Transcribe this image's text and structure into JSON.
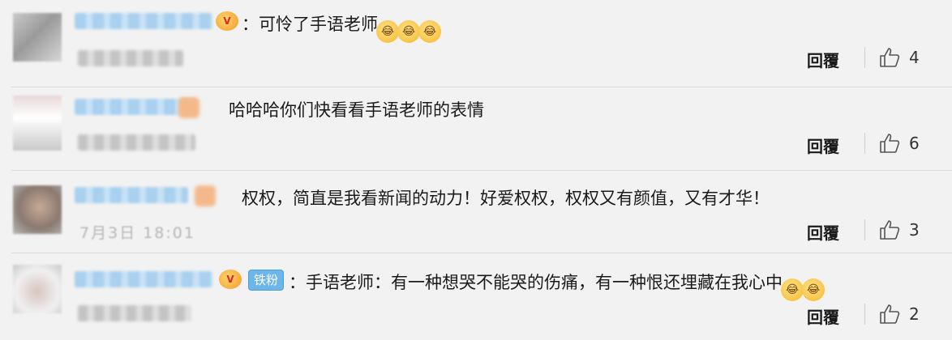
{
  "comments": [
    {
      "prefix": "：",
      "text": "可怜了手语老师",
      "emoji_count": 3,
      "emoji_icon": "laughing-crying-emoji",
      "badge_icon": "vip-crown-icon",
      "reply_label": "回覆",
      "likes": "4"
    },
    {
      "prefix": "",
      "text": "哈哈哈你们快看看手语老师的表情",
      "reply_label": "回覆",
      "likes": "6"
    },
    {
      "prefix": "",
      "text": "权权，简直是我看新闻的动力！好爱权权，权权又有颜值，又有才华！",
      "meta_text": "7月3日 18:01",
      "reply_label": "回覆",
      "likes": "3"
    },
    {
      "prefix": "：",
      "text": "手语老师：有一种想哭不能哭的伤痛，有一种恨还埋藏在我心中",
      "badge_icon": "vip-crown-icon",
      "fan_badge": "铁粉",
      "emoji_count": 2,
      "emoji_icon": "laughing-crying-emoji",
      "reply_label": "回覆",
      "likes": "2"
    }
  ],
  "icons": {
    "like": "thumbs-up-icon"
  },
  "colors": {
    "background": "#f2f2f2",
    "username_blur": "#a9d0ee",
    "fan_badge": "#6cb6ea"
  }
}
